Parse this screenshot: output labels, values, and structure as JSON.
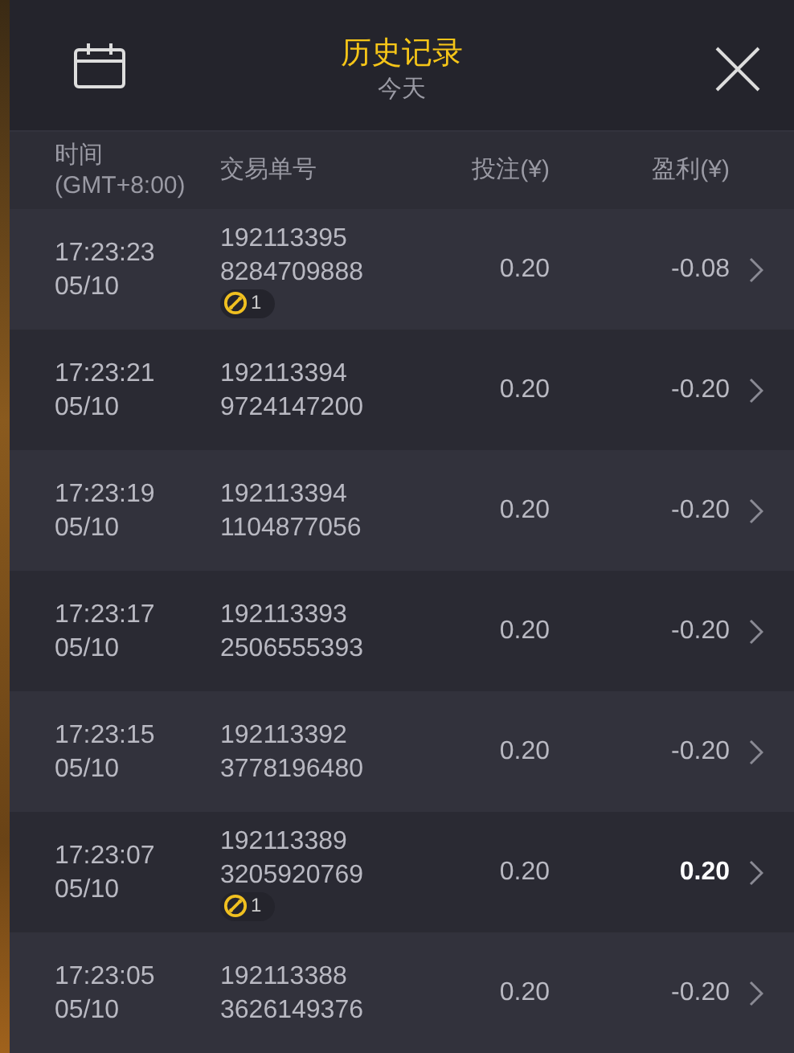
{
  "header": {
    "title": "历史记录",
    "subtitle": "今天"
  },
  "columns": [
    "时间\n(GMT+8:00)",
    "交易单号",
    "投注(¥)",
    "盈利(¥)"
  ],
  "rows": [
    {
      "time": "17:23:23",
      "date": "05/10",
      "order_1": "192113395",
      "order_2": "8284709888",
      "badge": "1",
      "bet": "0.20",
      "profit": "-0.08",
      "win": false
    },
    {
      "time": "17:23:21",
      "date": "05/10",
      "order_1": "192113394",
      "order_2": "9724147200",
      "bet": "0.20",
      "profit": "-0.20",
      "win": false
    },
    {
      "time": "17:23:19",
      "date": "05/10",
      "order_1": "192113394",
      "order_2": "1104877056",
      "bet": "0.20",
      "profit": "-0.20",
      "win": false
    },
    {
      "time": "17:23:17",
      "date": "05/10",
      "order_1": "192113393",
      "order_2": "2506555393",
      "bet": "0.20",
      "profit": "-0.20",
      "win": false
    },
    {
      "time": "17:23:15",
      "date": "05/10",
      "order_1": "192113392",
      "order_2": "3778196480",
      "bet": "0.20",
      "profit": "-0.20",
      "win": false
    },
    {
      "time": "17:23:07",
      "date": "05/10",
      "order_1": "192113389",
      "order_2": "3205920769",
      "badge": "1",
      "bet": "0.20",
      "profit": "0.20",
      "win": true
    },
    {
      "time": "17:23:05",
      "date": "05/10",
      "order_1": "192113388",
      "order_2": "3626149376",
      "bet": "0.20",
      "profit": "-0.20",
      "win": false
    }
  ]
}
